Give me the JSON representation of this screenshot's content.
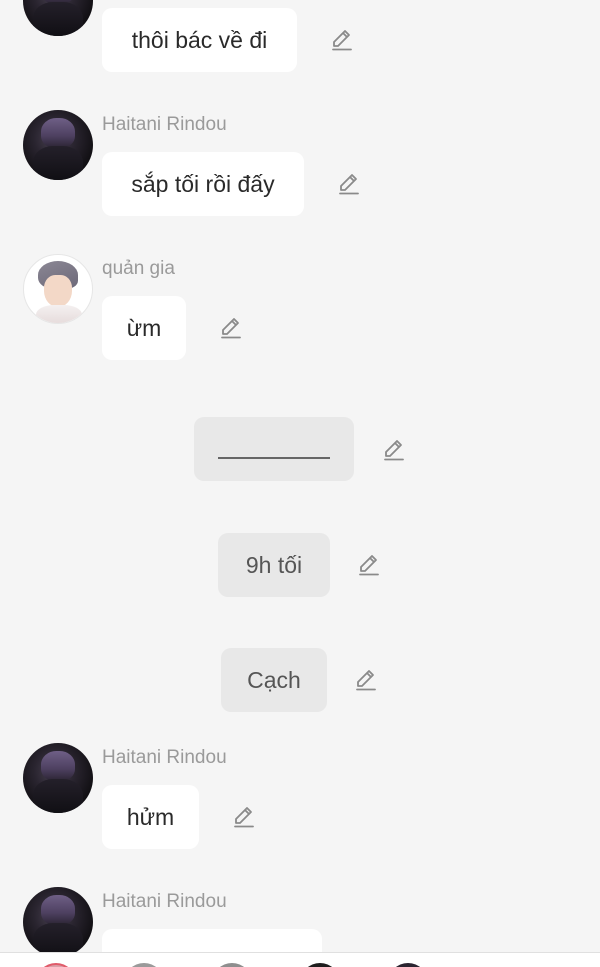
{
  "messages": [
    {
      "type": "bubble",
      "speaker": "",
      "text": "thôi bác về đi",
      "avatar": "haitani-rindou-avatar"
    },
    {
      "type": "bubble",
      "speaker": "Haitani Rindou",
      "text": "sắp tối rồi đấy",
      "avatar": "haitani-rindou-avatar"
    },
    {
      "type": "bubble",
      "speaker": "quản gia",
      "text": "ừm",
      "avatar": "quan-gia-avatar"
    },
    {
      "type": "narration",
      "text": ""
    },
    {
      "type": "narration",
      "text": "9h tối"
    },
    {
      "type": "narration",
      "text": "Cạch"
    },
    {
      "type": "bubble",
      "speaker": "Haitani Rindou",
      "text": "hửm",
      "avatar": "haitani-rindou-avatar"
    },
    {
      "type": "bubble",
      "speaker": "Haitani Rindou",
      "text": "",
      "avatar": "haitani-rindou-avatar"
    }
  ],
  "icons": {
    "edit": "pencil-edit-icon"
  },
  "colors": {
    "background": "#f5f5f5",
    "bubble": "#ffffff",
    "narration": "#e8e8e8",
    "speaker_name": "#9a9a9a",
    "text": "#2a2a2a"
  }
}
